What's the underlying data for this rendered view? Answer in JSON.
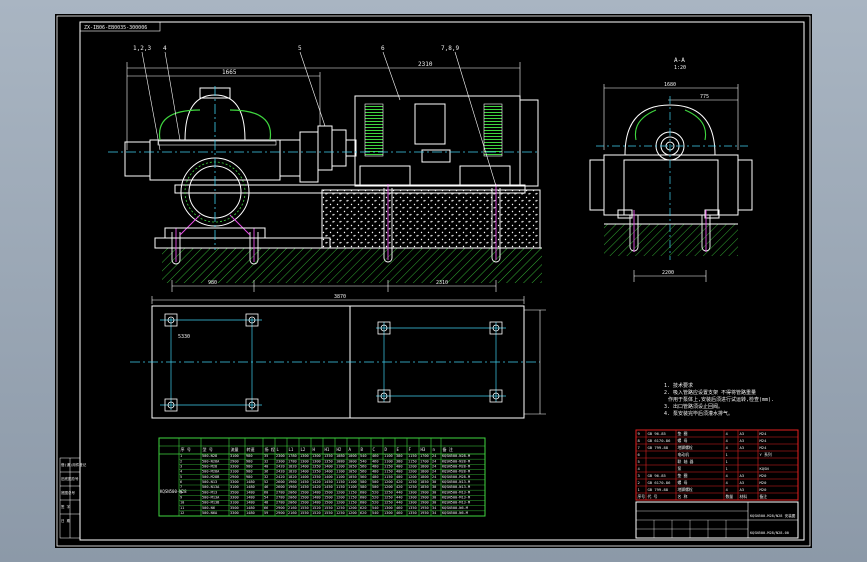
{
  "drawing": {
    "title_code": "ZX-IB06-EB0035-300006",
    "part_labels": [
      "1,2,3",
      "4",
      "5",
      "6",
      "7,8,9"
    ],
    "section_label": "A-A",
    "section_sub": "1:20",
    "dim_top_left": "1665",
    "dim_top_right": "2310",
    "dim_side_top": "1680",
    "dim_side_mid": "775",
    "dim_bottom_side": "2200",
    "dim_base_len": "3870",
    "dim_left_half": "5330",
    "dim_bottom_left": "980",
    "dim_bottom_right": "2310"
  },
  "notes": {
    "heading": "1. 技术要求",
    "lines": [
      "2. 吸入管路应设置支架 不得将管路重量",
      "作用于泵体上,安装后须进行试运转,检查(mm).",
      "3. 出口管路须设止回阀。",
      "4. 泵安装完毕后须灌水排气。"
    ]
  },
  "spec_table": {
    "header": [
      "序 号",
      "型 号",
      "流量",
      "转速",
      "扬 程",
      "L",
      "L1",
      "L2",
      "H",
      "H1",
      "H2",
      "A",
      "B",
      "C",
      "D",
      "E",
      "F",
      "H3",
      "n",
      "备 注"
    ],
    "group_label": "KQSN500-M28",
    "rows": [
      [
        "1",
        "500-N28",
        "3100",
        "980",
        "35",
        "2300",
        "1780",
        "1300",
        "1300",
        "1350",
        "1080",
        "1000",
        "540",
        "460",
        "1100",
        "380",
        "1150",
        "1700",
        "24",
        "KQSN500-N28-M"
      ],
      [
        "2",
        "500-N28A",
        "2900",
        "980",
        "32",
        "2300",
        "1780",
        "1300",
        "1300",
        "1350",
        "1080",
        "1000",
        "540",
        "460",
        "1100",
        "380",
        "1150",
        "1700",
        "24",
        "KQSN500-N28-M"
      ],
      [
        "3",
        "500-M28",
        "3300",
        "980",
        "40",
        "2420",
        "1820",
        "1400",
        "1350",
        "1400",
        "1100",
        "1050",
        "560",
        "480",
        "1150",
        "400",
        "1200",
        "1800",
        "24",
        "KQSN500-M28-M"
      ],
      [
        "4",
        "500-M28A",
        "3100",
        "980",
        "36",
        "2420",
        "1820",
        "1400",
        "1350",
        "1400",
        "1100",
        "1050",
        "560",
        "480",
        "1150",
        "400",
        "1200",
        "1800",
        "24",
        "KQSN500-M28-M"
      ],
      [
        "5",
        "500-M28B",
        "2900",
        "980",
        "32",
        "2420",
        "1820",
        "1400",
        "1350",
        "1400",
        "1100",
        "1050",
        "560",
        "480",
        "1150",
        "400",
        "1200",
        "1800",
        "24",
        "KQSN500-M28-M"
      ],
      [
        "6",
        "500-N13",
        "3300",
        "1480",
        "52",
        "2600",
        "1960",
        "1450",
        "1420",
        "1450",
        "1150",
        "1100",
        "580",
        "500",
        "1200",
        "420",
        "1250",
        "1850",
        "30",
        "KQSN500-N13-M"
      ],
      [
        "7",
        "500-N13A",
        "3100",
        "1480",
        "46",
        "2600",
        "1960",
        "1450",
        "1420",
        "1450",
        "1150",
        "1100",
        "580",
        "500",
        "1200",
        "420",
        "1250",
        "1850",
        "30",
        "KQSN500-N13-M"
      ],
      [
        "8",
        "500-M13",
        "3500",
        "1480",
        "60",
        "2780",
        "2060",
        "1500",
        "1480",
        "1500",
        "1200",
        "1150",
        "600",
        "520",
        "1250",
        "440",
        "1300",
        "1900",
        "30",
        "KQSN500-M13-M"
      ],
      [
        "9",
        "500-M13A",
        "3300",
        "1480",
        "54",
        "2780",
        "2060",
        "1500",
        "1480",
        "1500",
        "1200",
        "1150",
        "600",
        "520",
        "1250",
        "440",
        "1300",
        "1900",
        "30",
        "KQSN500-M13-M"
      ],
      [
        "10",
        "500-M13B",
        "3100",
        "1480",
        "48",
        "2780",
        "2060",
        "1500",
        "1480",
        "1500",
        "1200",
        "1150",
        "600",
        "520",
        "1250",
        "440",
        "1300",
        "1900",
        "30",
        "KQSN500-M13-M"
      ],
      [
        "11",
        "500-N6",
        "3500",
        "1480",
        "66",
        "2900",
        "2160",
        "1550",
        "1520",
        "1550",
        "1250",
        "1200",
        "620",
        "540",
        "1300",
        "460",
        "1350",
        "1950",
        "34",
        "KQSN500-N6-M"
      ],
      [
        "12",
        "500-N6A",
        "3300",
        "1480",
        "59",
        "2900",
        "2160",
        "1550",
        "1520",
        "1550",
        "1250",
        "1200",
        "620",
        "540",
        "1300",
        "460",
        "1350",
        "1950",
        "34",
        "KQSN500-N6-M"
      ]
    ]
  },
  "title_block": {
    "parts_rows": [
      [
        "9",
        "GB 96-85",
        "垫 圈",
        "4",
        "A3",
        "M24"
      ],
      [
        "8",
        "GB 6170-86",
        "螺 母",
        "4",
        "A3",
        "M24"
      ],
      [
        "7",
        "GB 799-88",
        "地脚螺栓",
        "4",
        "A3",
        "M24"
      ],
      [
        "6",
        "",
        "电动机",
        "1",
        "",
        "Y 系列"
      ],
      [
        "5",
        "",
        "联 轴 器",
        "1",
        "",
        ""
      ],
      [
        "4",
        "",
        "泵",
        "1",
        "",
        "KQSN"
      ],
      [
        "3",
        "GB 96-85",
        "垫 圈",
        "4",
        "A3",
        "M20"
      ],
      [
        "2",
        "GB 6170-86",
        "螺 母",
        "4",
        "A3",
        "M20"
      ],
      [
        "1",
        "GB 799-88",
        "地脚螺栓",
        "4",
        "A3",
        "M20"
      ]
    ],
    "header": [
      "序号",
      "代 号",
      "名 称",
      "数量",
      "材料",
      "备注"
    ],
    "drawing_name": "KQSN500-M28/N28 安装图",
    "drawing_number": "KQSN500-M28/N28-00"
  },
  "side_stamp": [
    "借(通)用件登记",
    "旧底图总号",
    "底图总号",
    "签 字",
    "日 期"
  ]
}
